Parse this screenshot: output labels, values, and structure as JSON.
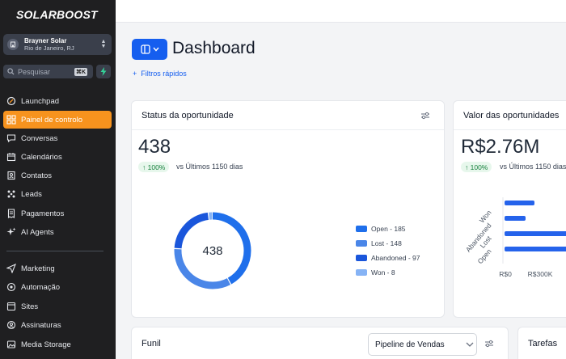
{
  "app": {
    "logo": "SOLARBOOST"
  },
  "account": {
    "name": "Brayner Solar",
    "location": "Rio de Janeiro, RJ"
  },
  "search": {
    "placeholder": "Pesquisar",
    "shortcut": "⌘K"
  },
  "sidebar": {
    "items": [
      {
        "label": "Launchpad",
        "icon": "rocket-icon",
        "active": false
      },
      {
        "label": "Painel de controlo",
        "icon": "dashboard-grid-icon",
        "active": true
      },
      {
        "label": "Conversas",
        "icon": "chat-icon",
        "active": false
      },
      {
        "label": "Calendários",
        "icon": "calendar-icon",
        "active": false
      },
      {
        "label": "Contatos",
        "icon": "contacts-icon",
        "active": false
      },
      {
        "label": "Leads",
        "icon": "leads-icon",
        "active": false
      },
      {
        "label": "Pagamentos",
        "icon": "receipt-icon",
        "active": false
      },
      {
        "label": "AI Agents",
        "icon": "sparkle-icon",
        "active": false
      },
      {
        "label": "Marketing",
        "icon": "send-icon",
        "active": false
      },
      {
        "label": "Automação",
        "icon": "automation-icon",
        "active": false
      },
      {
        "label": "Sites",
        "icon": "globe-icon",
        "active": false
      },
      {
        "label": "Assinaturas",
        "icon": "subscription-icon",
        "active": false
      },
      {
        "label": "Media Storage",
        "icon": "media-icon",
        "active": false
      }
    ]
  },
  "header": {
    "title": "Dashboard",
    "filters": "Filtros rápidos"
  },
  "cards": {
    "status": {
      "title": "Status da oportunidade",
      "value": "438",
      "badge": "100%",
      "compare": "vs Últimos 1150 dias",
      "center": "438"
    },
    "valor": {
      "title": "Valor das oportunidades",
      "value": "R$2.76M",
      "badge": "100%",
      "compare": "vs Últimos 1150 dias"
    },
    "funil": {
      "title": "Funil",
      "pipeline": "Pipeline de Vendas"
    },
    "tarefas": {
      "title": "Tarefas"
    }
  },
  "colors": {
    "accent": "#f7931e",
    "primary": "#155eef",
    "open": "#1f6feb",
    "lost": "#4a86e8",
    "abandoned": "#1a56db",
    "won": "#86b3f5"
  },
  "chart_data": [
    {
      "type": "pie",
      "categories": [
        "Open",
        "Lost",
        "Abandoned",
        "Won"
      ],
      "values": [
        185,
        148,
        97,
        8
      ],
      "legend": [
        "Open - 185",
        "Lost - 148",
        "Abandoned - 97",
        "Won - 8"
      ],
      "legend_position": "right"
    },
    {
      "type": "bar",
      "orientation": "horizontal",
      "categories": [
        "Won",
        "Abandoned",
        "Lost",
        "Open"
      ],
      "tick_labels": [
        "R$0",
        "R$300K"
      ]
    }
  ]
}
